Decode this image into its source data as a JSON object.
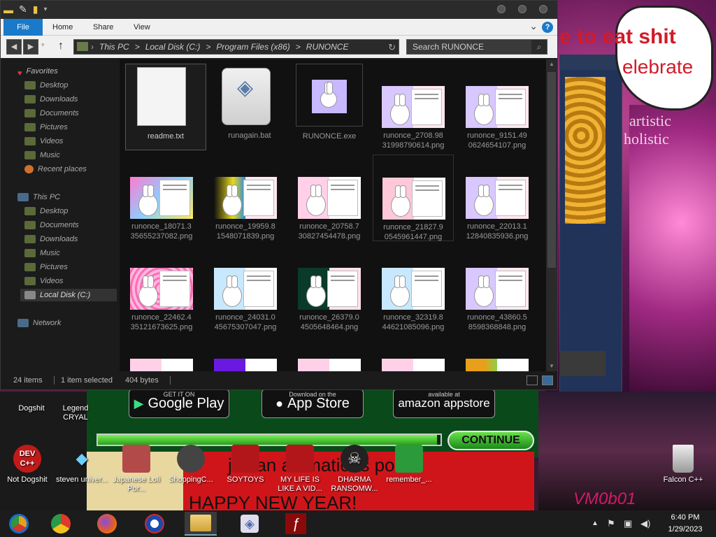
{
  "background": {
    "speech_text_1": "e to eat shit",
    "speech_text_2": "elebrate",
    "side_text_1": "artistic",
    "side_text_2": "holistic",
    "store_google_small": "GET IT ON",
    "store_google": "Google Play",
    "store_apple_small": "Download on the",
    "store_apple": "App Store",
    "store_amazon_small": "available at",
    "store_amazon": "amazon appstore",
    "continue_label": "CONTINUE",
    "progress_fraction": 0.99,
    "bottom_text_1": "jaidan animations porn",
    "bottom_text_2": "HAPPY NEW YEAR!",
    "bottom_text_3": "VM0b01"
  },
  "desktop_icons": [
    {
      "label": "Dogshit",
      "icon": "image-icon"
    },
    {
      "label": "Legend CRYAL",
      "icon": "image-icon"
    },
    {
      "label": "Not Dogshit",
      "icon": "devcpp-icon",
      "glyph_text": "DEV C++"
    },
    {
      "label": "steven univer...",
      "icon": "gem-icon"
    },
    {
      "label": "Japanese Loli Por...",
      "icon": "shortcut-icon"
    },
    {
      "label": "ShoppingC...",
      "icon": "globe-icon"
    },
    {
      "label": "SOYTOYS",
      "icon": "app-icon"
    },
    {
      "label": "MY LIFE IS LIKE A VID...",
      "icon": "app-icon"
    },
    {
      "label": "DHARMA RANSOMW...",
      "icon": "skull-icon"
    },
    {
      "label": "remember_...",
      "icon": "image-icon"
    },
    {
      "label": "Falcon C++",
      "icon": "recycle-bin-icon"
    }
  ],
  "explorer": {
    "tabs": [
      "File",
      "Home",
      "Share",
      "View"
    ],
    "help": "?",
    "address": [
      "This PC",
      "Local Disk (C:)",
      "Program Files (x86)",
      "RUNONCE"
    ],
    "address_separator": ">",
    "search_placeholder": "Search RUNONCE",
    "sidebar": {
      "favorites_label": "Favorites",
      "favorites": [
        "Desktop",
        "Downloads",
        "Documents",
        "Pictures",
        "Videos",
        "Music",
        "Recent places"
      ],
      "this_pc_label": "This PC",
      "this_pc": [
        "Desktop",
        "Documents",
        "Downloads",
        "Music",
        "Pictures",
        "Videos",
        "Local Disk (C:)"
      ],
      "network_label": "Network"
    },
    "files": [
      {
        "name": "readme.txt",
        "kind": "txt"
      },
      {
        "name": "runagain.bat",
        "kind": "bat"
      },
      {
        "name": "RUNONCE.exe",
        "kind": "exe"
      },
      {
        "name": "runonce_2708.98 31998790614.png",
        "kind": "png"
      },
      {
        "name": "runonce_9151.49 0624654107.png",
        "kind": "png"
      },
      {
        "name": "runonce_18071.3 35655237082.png",
        "kind": "png"
      },
      {
        "name": "runonce_19959.8 1548071839.png",
        "kind": "png"
      },
      {
        "name": "runonce_20758.7 30827454478.png",
        "kind": "png"
      },
      {
        "name": "runonce_21827.9 0545961447.png",
        "kind": "png"
      },
      {
        "name": "runonce_22013.1 12840835936.png",
        "kind": "png"
      },
      {
        "name": "runonce_22462.4 35121673625.png",
        "kind": "png"
      },
      {
        "name": "runonce_24031.0 45675307047.png",
        "kind": "png"
      },
      {
        "name": "runonce_26379.0 4505648464.png",
        "kind": "png"
      },
      {
        "name": "runonce_32319.8 44621085096.png",
        "kind": "png"
      },
      {
        "name": "runonce_43860.5 8598368848.png",
        "kind": "png"
      }
    ],
    "status": {
      "items": "24 items",
      "selected": "1 item selected",
      "size": "404 bytes"
    }
  },
  "taskbar": {
    "apps": [
      "chrome-canary-icon",
      "chrome-icon",
      "firefox-icon",
      "edge-icon",
      "file-explorer-icon",
      "runonce-icon",
      "flash-icon"
    ],
    "time": "6:40 PM",
    "date": "1/29/2023"
  }
}
